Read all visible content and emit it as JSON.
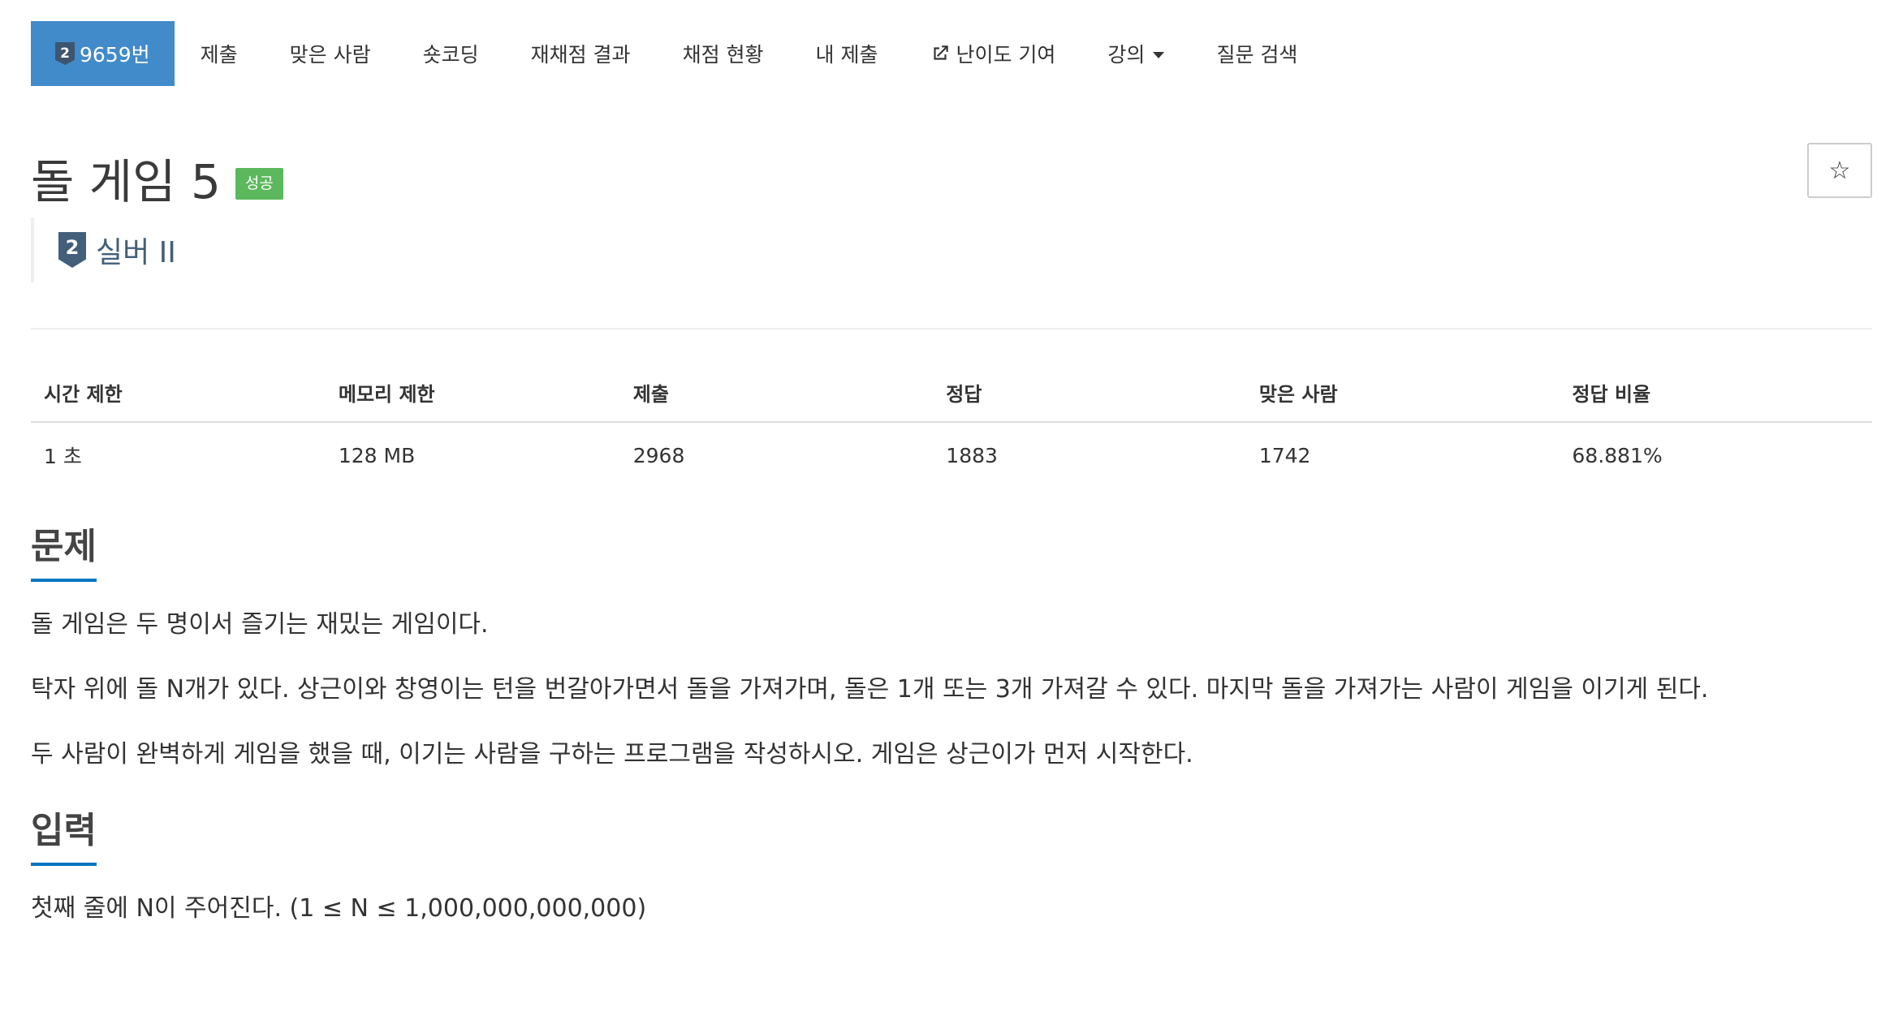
{
  "tabs": [
    {
      "label": "9659번",
      "badge": "2",
      "active": true
    },
    {
      "label": "제출"
    },
    {
      "label": "맞은 사람"
    },
    {
      "label": "숏코딩"
    },
    {
      "label": "재채점 결과"
    },
    {
      "label": "채점 현황"
    },
    {
      "label": "내 제출"
    },
    {
      "label": "난이도 기여"
    },
    {
      "label": "강의"
    },
    {
      "label": "질문 검색"
    }
  ],
  "problem": {
    "title": "돌 게임 5",
    "status_badge": "성공",
    "star": "☆",
    "tier_number": "2",
    "tier_label": "실버 II"
  },
  "info": {
    "headers": [
      "시간 제한",
      "메모리 제한",
      "제출",
      "정답",
      "맞은 사람",
      "정답 비율"
    ],
    "values": [
      "1 초",
      "128 MB",
      "2968",
      "1883",
      "1742",
      "68.881%"
    ]
  },
  "sections": {
    "description": {
      "title": "문제",
      "paragraphs": [
        "돌 게임은 두 명이서 즐기는 재밌는 게임이다.",
        "탁자 위에 돌 N개가 있다. 상근이와 창영이는 턴을 번갈아가면서 돌을 가져가며, 돌은 1개 또는 3개 가져갈 수 있다. 마지막 돌을 가져가는 사람이 게임을 이기게 된다.",
        "두 사람이 완벽하게 게임을 했을 때, 이기는 사람을 구하는 프로그램을 작성하시오. 게임은 상근이가 먼저 시작한다."
      ]
    },
    "input": {
      "title": "입력",
      "paragraphs": [
        "첫째 줄에 N이 주어진다. (1 ≤ N ≤ 1,000,000,000,000)"
      ]
    }
  },
  "colors": {
    "active_tab": "#428bca",
    "success": "#5cb85c",
    "tier": "#435f7a",
    "section_underline": "#0076c0"
  }
}
